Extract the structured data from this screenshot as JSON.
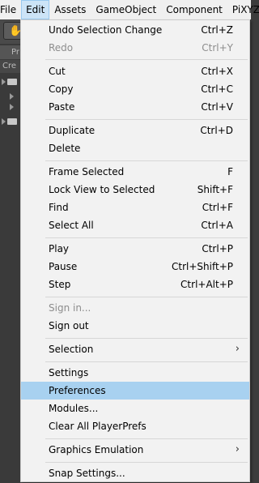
{
  "menubar": {
    "items": [
      "File",
      "Edit",
      "Assets",
      "GameObject",
      "Component",
      "PiXYZ"
    ],
    "active_index": 1
  },
  "editor_bg": {
    "panel_tab_label": "Pr",
    "create_label": "Cre"
  },
  "edit_menu": {
    "highlight_color": "#a8d1f0",
    "items": [
      {
        "label": "Undo Selection Change",
        "shortcut": "Ctrl+Z",
        "enabled": true
      },
      {
        "label": "Redo",
        "shortcut": "Ctrl+Y",
        "enabled": false
      },
      {
        "label": "Cut",
        "shortcut": "Ctrl+X",
        "enabled": true
      },
      {
        "label": "Copy",
        "shortcut": "Ctrl+C",
        "enabled": true
      },
      {
        "label": "Paste",
        "shortcut": "Ctrl+V",
        "enabled": true
      },
      {
        "label": "Duplicate",
        "shortcut": "Ctrl+D",
        "enabled": true
      },
      {
        "label": "Delete",
        "shortcut": "",
        "enabled": true
      },
      {
        "label": "Frame Selected",
        "shortcut": "F",
        "enabled": true
      },
      {
        "label": "Lock View to Selected",
        "shortcut": "Shift+F",
        "enabled": true
      },
      {
        "label": "Find",
        "shortcut": "Ctrl+F",
        "enabled": true
      },
      {
        "label": "Select All",
        "shortcut": "Ctrl+A",
        "enabled": true
      },
      {
        "label": "Play",
        "shortcut": "Ctrl+P",
        "enabled": true
      },
      {
        "label": "Pause",
        "shortcut": "Ctrl+Shift+P",
        "enabled": true
      },
      {
        "label": "Step",
        "shortcut": "Ctrl+Alt+P",
        "enabled": true
      },
      {
        "label": "Sign in...",
        "shortcut": "",
        "enabled": false
      },
      {
        "label": "Sign out",
        "shortcut": "",
        "enabled": true
      },
      {
        "label": "Selection",
        "shortcut": "",
        "enabled": true,
        "submenu": true
      },
      {
        "label": "Settings",
        "shortcut": "",
        "enabled": true
      },
      {
        "label": "Preferences",
        "shortcut": "",
        "enabled": true,
        "highlighted": true
      },
      {
        "label": "Modules...",
        "shortcut": "",
        "enabled": true
      },
      {
        "label": "Clear All PlayerPrefs",
        "shortcut": "",
        "enabled": true
      },
      {
        "label": "Graphics Emulation",
        "shortcut": "",
        "enabled": true,
        "submenu": true
      },
      {
        "label": "Snap Settings...",
        "shortcut": "",
        "enabled": true
      }
    ],
    "submenu_arrow": "›"
  }
}
